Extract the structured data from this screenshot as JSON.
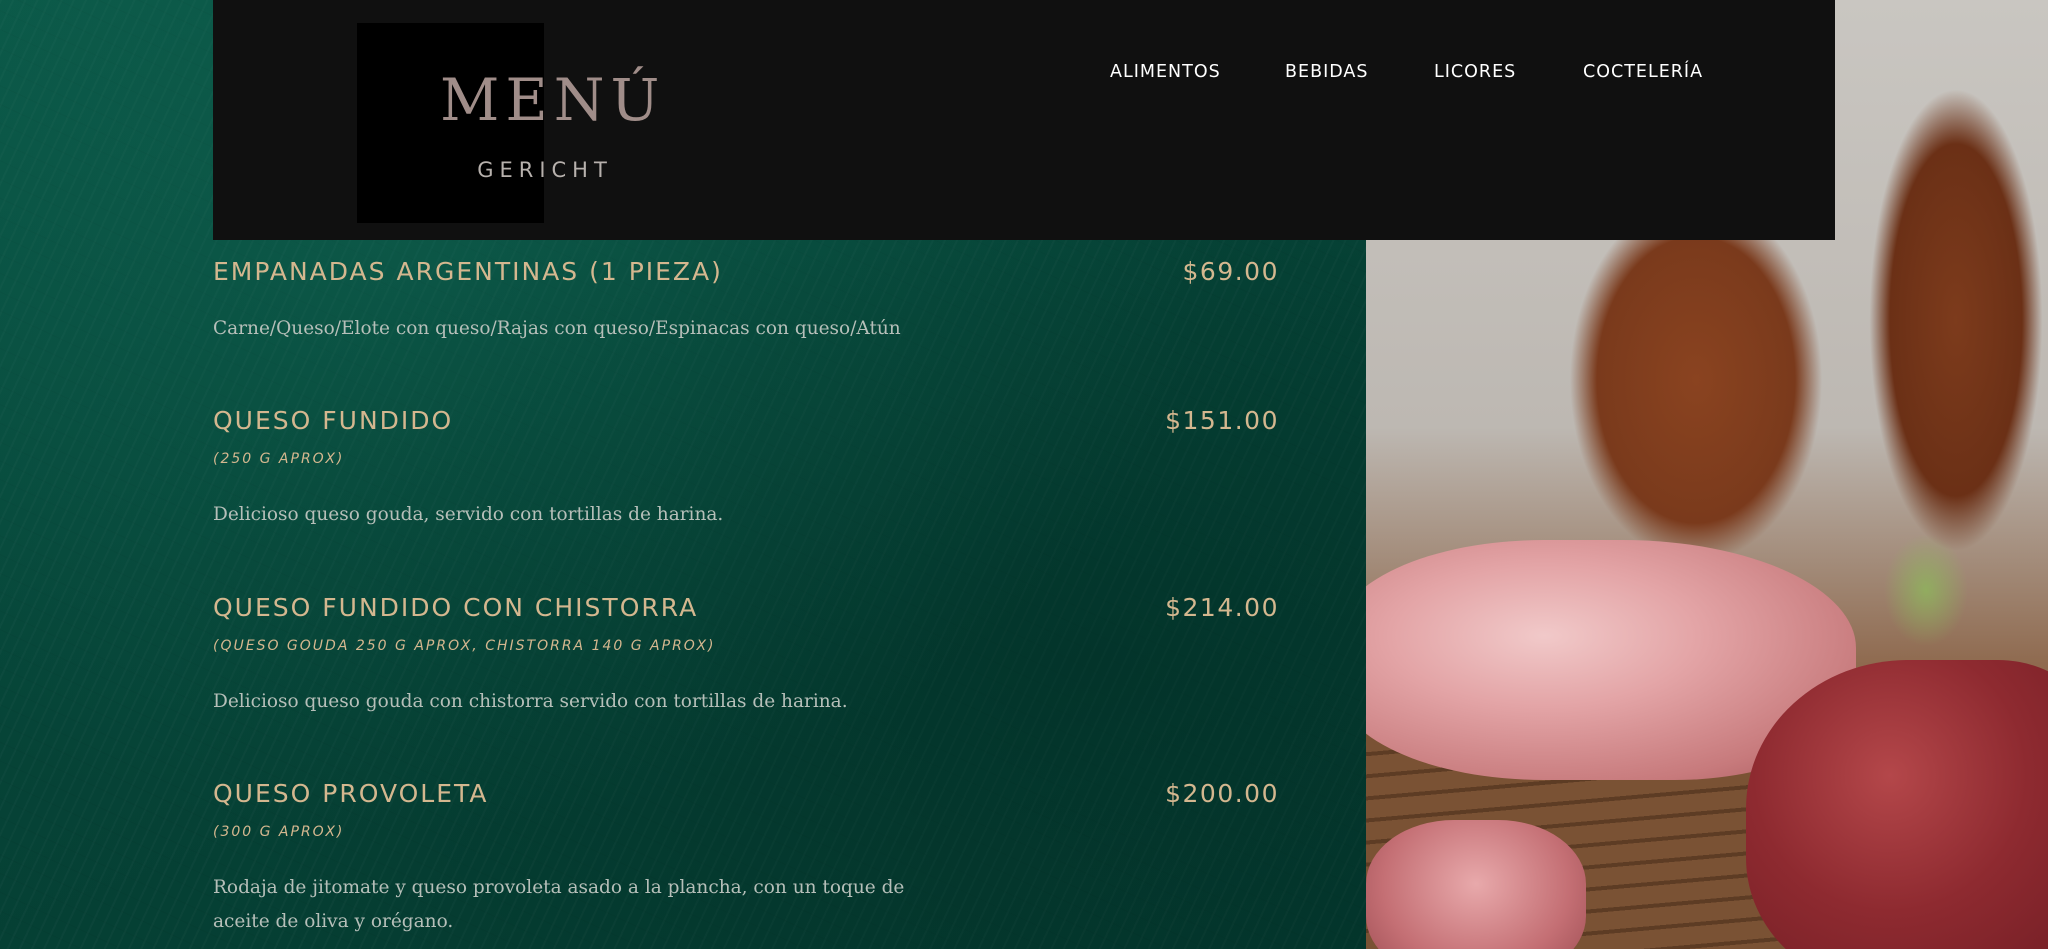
{
  "header": {
    "logo_title": "MENÚ",
    "logo_subtitle": "GERICHT"
  },
  "nav": {
    "items": [
      {
        "label": "ALIMENTOS"
      },
      {
        "label": "BEBIDAS"
      },
      {
        "label": "LICORES"
      },
      {
        "label": "COCTELERÍA"
      }
    ]
  },
  "menu": {
    "items": [
      {
        "name": "EMPANADAS ARGENTINAS (1 PIEZA)",
        "price": "$69.00",
        "portion": "",
        "description": "Carne/Queso/Elote con queso/Rajas con queso/Espinacas con queso/Atún"
      },
      {
        "name": "QUESO FUNDIDO",
        "price": "$151.00",
        "portion": "(250 G APROX)",
        "description": "Delicioso queso gouda, servido con tortillas de harina."
      },
      {
        "name": "QUESO FUNDIDO CON CHISTORRA",
        "price": "$214.00",
        "portion": "(QUESO GOUDA 250 G APROX, CHISTORRA 140 G APROX)",
        "description": "Delicioso queso gouda con chistorra servido con tortillas de harina."
      },
      {
        "name": "QUESO PROVOLETA",
        "price": "$200.00",
        "portion": "(300 G APROX)",
        "description": "Rodaja de jitomate y queso provoleta asado a la plancha, con un toque de aceite de oliva y orégano."
      }
    ]
  },
  "theme": {
    "background_green": "#07463a",
    "header_black": "#101010",
    "accent_gold": "#d4b78f",
    "logo_color": "#a08d89",
    "description_color": "#b6bfb9"
  }
}
